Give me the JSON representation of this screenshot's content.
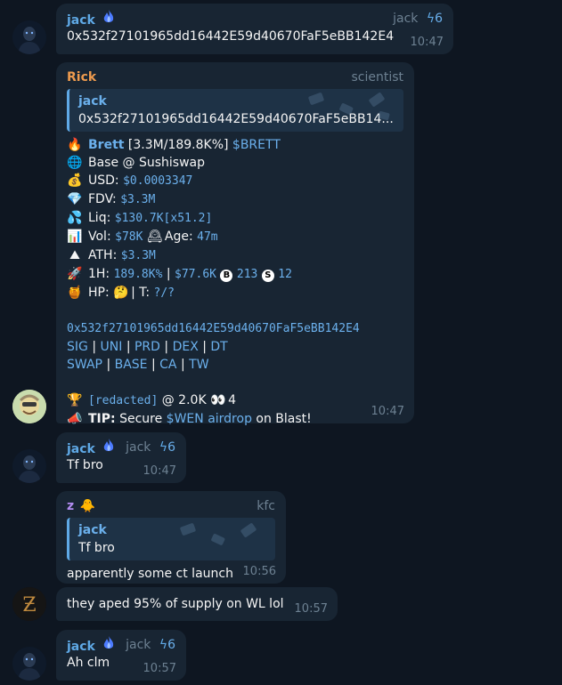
{
  "msg1": {
    "sender": "jack",
    "role": "jack",
    "role_num": "6",
    "text": "0x532f27101965dd16442E59d40670FaF5eBB142E4",
    "time": "10:47"
  },
  "msg2": {
    "sender": "Rick",
    "role": "scientist",
    "quote": {
      "sender": "jack",
      "text": "0x532f27101965dd16442E59d40670FaF5eBB14..."
    },
    "token_name": "Brett",
    "token_stats": "[3.3M/189.8K%]",
    "token_ticker": "$BRETT",
    "chain": "Base @ Sushiswap",
    "usd_label": "USD:",
    "usd_value": "$0.0003347",
    "fdv_label": "FDV:",
    "fdv_value": "$3.3M",
    "liq_label": "Liq:",
    "liq_value": "$130.7K",
    "liq_mult": "[x51.2]",
    "vol_label": "Vol:",
    "vol_value": "$78K",
    "age_label": "Age:",
    "age_value": "47m",
    "ath_label": "ATH:",
    "ath_value": "$3.3M",
    "h1_label": "1H:",
    "h1_pct": "189.8K%",
    "h1_sep": "|",
    "h1_usd": "$77.6K",
    "h1_buys": "213",
    "h1_sells": "12",
    "hp_label": "HP:",
    "hp_t": "| T:",
    "hp_t_value": "?/?",
    "contract": "0x532f27101965dd16442E59d40670FaF5eBB142E4",
    "links_row1": [
      "SIG",
      "UNI",
      "PRD",
      "DEX",
      "DT"
    ],
    "links_row2": [
      "SWAP",
      "BASE",
      "CA",
      "TW"
    ],
    "caller": "[redacted]",
    "caller_mc": "@ 2.0K",
    "caller_count": "4",
    "tip_label": "TIP:",
    "tip_pre": "Secure",
    "tip_link": "$WEN airdrop",
    "tip_post": "on Blast!",
    "time": "10:47"
  },
  "msg3": {
    "sender": "jack",
    "role": "jack",
    "role_num": "6",
    "text": "Tf bro",
    "time": "10:47"
  },
  "msg4": {
    "sender": "z",
    "role": "kfc",
    "quote": {
      "sender": "jack",
      "text": "Tf bro"
    },
    "text": "apparently some ct launch",
    "time": "10:56"
  },
  "msg5": {
    "text": "they aped 95% of supply on WL lol",
    "time": "10:57"
  },
  "msg6": {
    "sender": "jack",
    "role": "jack",
    "role_num": "6",
    "text": "Ah clm",
    "time": "10:57"
  },
  "colors": {
    "background": "#0e1621",
    "bubble": "#182533",
    "link": "#6bb0ec",
    "jack": "#5fa9e6",
    "rick": "#ee9b4e",
    "z": "#b28cf0"
  },
  "icons": [
    "blue-flame-icon",
    "pulse-icon",
    "fire-icon",
    "globe-icon",
    "money-bag-icon",
    "gem-icon",
    "droplets-icon",
    "bar-chart-icon",
    "clock-icon",
    "mountain-icon",
    "rocket-icon",
    "honey-pot-icon",
    "thinking-face-icon",
    "b-circle-icon",
    "s-circle-icon",
    "trophy-icon",
    "eyes-icon",
    "megaphone-icon",
    "duck-icon"
  ]
}
